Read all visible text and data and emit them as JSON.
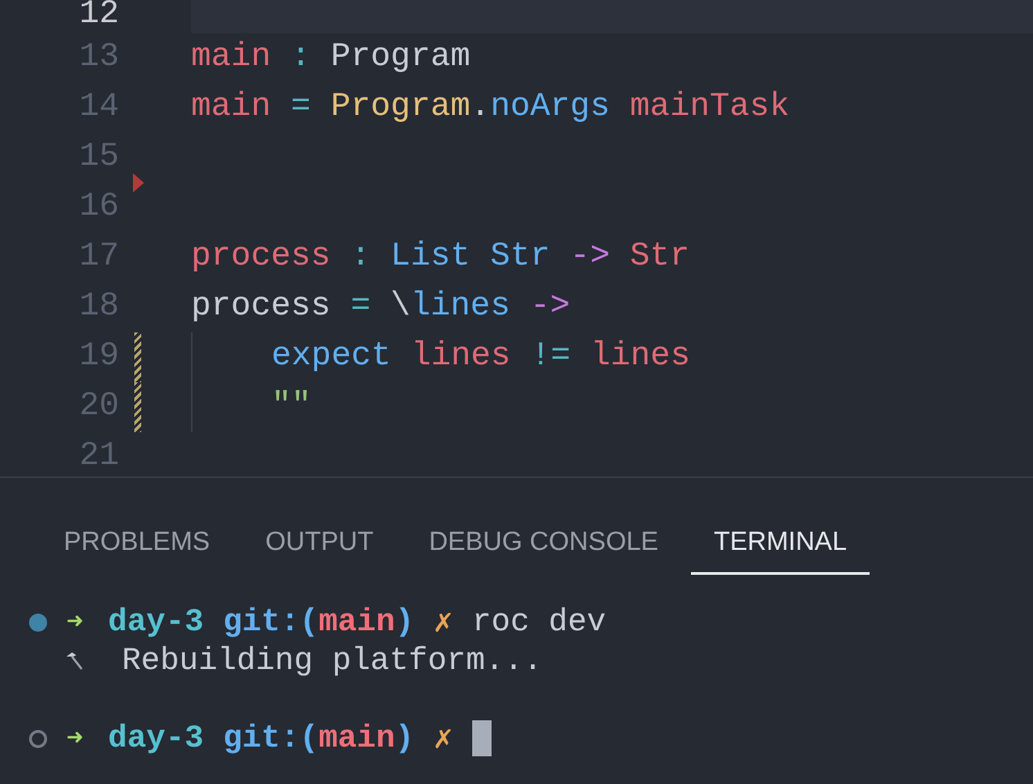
{
  "editor": {
    "lines": [
      {
        "number": "12",
        "current": true
      },
      {
        "number": "13",
        "current": false,
        "tokens": [
          {
            "text": "main",
            "kind": "variable"
          },
          {
            "text": " : ",
            "kind": "operator"
          },
          {
            "text": "Program",
            "kind": "plain"
          }
        ]
      },
      {
        "number": "14",
        "current": false,
        "tokens": [
          {
            "text": "main",
            "kind": "variable"
          },
          {
            "text": " = ",
            "kind": "operator"
          },
          {
            "text": "Program",
            "kind": "module"
          },
          {
            "text": ".",
            "kind": "plain"
          },
          {
            "text": "noArgs",
            "kind": "function"
          },
          {
            "text": " mainTask",
            "kind": "variable"
          }
        ]
      },
      {
        "number": "15",
        "current": false,
        "deleted_below": true
      },
      {
        "number": "16",
        "current": false
      },
      {
        "number": "17",
        "current": false,
        "tokens": [
          {
            "text": "process",
            "kind": "variable"
          },
          {
            "text": " : ",
            "kind": "operator"
          },
          {
            "text": "List Str",
            "kind": "function"
          },
          {
            "text": " -> ",
            "kind": "keyword"
          },
          {
            "text": "Str",
            "kind": "variable"
          }
        ]
      },
      {
        "number": "18",
        "current": false,
        "tokens": [
          {
            "text": "process",
            "kind": "plain"
          },
          {
            "text": " = ",
            "kind": "operator"
          },
          {
            "text": "\\",
            "kind": "plain"
          },
          {
            "text": "lines",
            "kind": "function"
          },
          {
            "text": " ->",
            "kind": "keyword"
          }
        ]
      },
      {
        "number": "19",
        "current": false,
        "modified": true,
        "indented": true,
        "tokens": [
          {
            "text": "expect",
            "kind": "function"
          },
          {
            "text": " lines",
            "kind": "variable"
          },
          {
            "text": " != ",
            "kind": "operator"
          },
          {
            "text": "lines",
            "kind": "variable"
          }
        ]
      },
      {
        "number": "20",
        "current": false,
        "modified": true,
        "indented": true,
        "tokens": [
          {
            "text": "\"\"",
            "kind": "string"
          }
        ]
      },
      {
        "number": "21",
        "current": false
      }
    ]
  },
  "panel": {
    "tabs": [
      {
        "label": "PROBLEMS",
        "selected": false
      },
      {
        "label": "OUTPUT",
        "selected": false
      },
      {
        "label": "DEBUG CONSOLE",
        "selected": false
      },
      {
        "label": "TERMINAL",
        "selected": true
      }
    ],
    "terminal": [
      {
        "kind": "prompt",
        "ran": true,
        "arrow": "➜",
        "dir": "day-3",
        "git": "git:(",
        "branch": "main",
        "git_end": ")",
        "dirty": "✗",
        "command": "roc dev",
        "cursor": false
      },
      {
        "kind": "output",
        "text": "Rebuilding platform..."
      },
      {
        "kind": "prompt",
        "ran": false,
        "arrow": "➜",
        "dir": "day-3",
        "git": "git:(",
        "branch": "main",
        "git_end": ")",
        "dirty": "✗",
        "cursor": true
      }
    ]
  }
}
